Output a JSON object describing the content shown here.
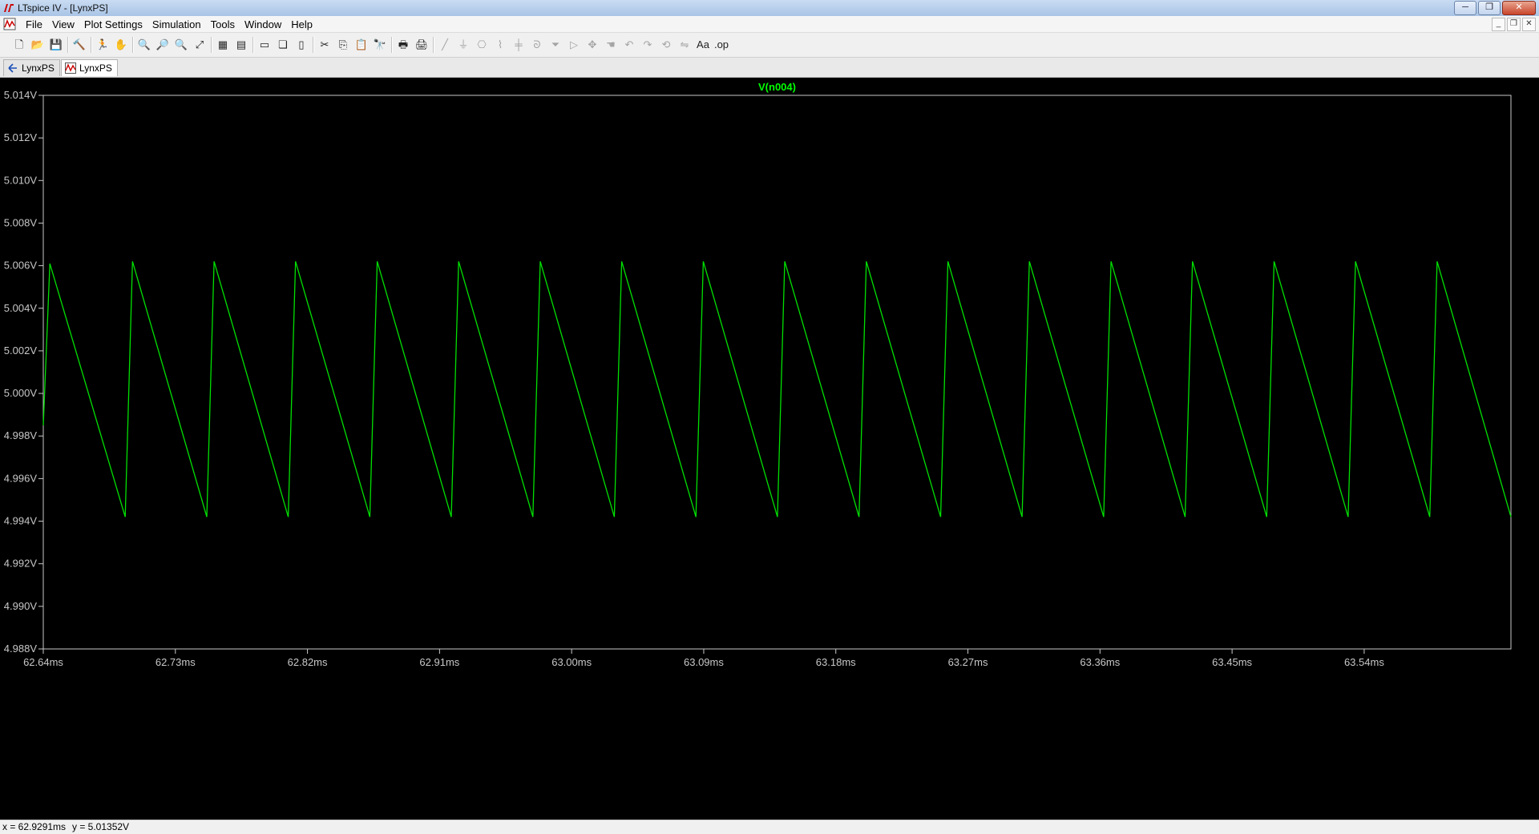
{
  "window": {
    "title": "LTspice IV - [LynxPS]",
    "buttons": {
      "minimize": "─",
      "restore": "❐",
      "close": "✕"
    }
  },
  "menubar": {
    "items": [
      "File",
      "View",
      "Plot Settings",
      "Simulation",
      "Tools",
      "Window",
      "Help"
    ],
    "mdi_buttons": {
      "minimize": "_",
      "restore": "❐",
      "close": "✕"
    }
  },
  "toolbar": {
    "buttons": [
      {
        "name": "open-schematic-icon",
        "glyph": "🗋"
      },
      {
        "name": "open-folder-icon",
        "glyph": "📂"
      },
      {
        "name": "save-icon",
        "glyph": "💾"
      },
      {
        "name": "control-panel-icon",
        "glyph": "🔨"
      },
      {
        "name": "run-icon",
        "glyph": "🏃"
      },
      {
        "name": "halt-icon",
        "glyph": "✋"
      },
      {
        "name": "zoom-in-icon",
        "glyph": "🔍"
      },
      {
        "name": "zoom-rect-icon",
        "glyph": "🔎"
      },
      {
        "name": "zoom-out-icon",
        "glyph": "🔍"
      },
      {
        "name": "zoom-fit-icon",
        "glyph": "⤢"
      },
      {
        "name": "autorange-icon",
        "glyph": "▦"
      },
      {
        "name": "grid-icon",
        "glyph": "▤"
      },
      {
        "name": "tile-horizontal-icon",
        "glyph": "▭"
      },
      {
        "name": "cascade-icon",
        "glyph": "❏"
      },
      {
        "name": "tile-vertical-icon",
        "glyph": "▯"
      },
      {
        "name": "cut-icon",
        "glyph": "✂"
      },
      {
        "name": "copy-icon",
        "glyph": "⎘"
      },
      {
        "name": "paste-icon",
        "glyph": "📋"
      },
      {
        "name": "find-icon",
        "glyph": "🔭"
      },
      {
        "name": "print-preview-icon",
        "glyph": "🖶"
      },
      {
        "name": "print-icon",
        "glyph": "🖨"
      },
      {
        "name": "wire-icon",
        "glyph": "╱"
      },
      {
        "name": "ground-icon",
        "glyph": "⏚"
      },
      {
        "name": "label-icon",
        "glyph": "⎔"
      },
      {
        "name": "resistor-icon",
        "glyph": "⌇"
      },
      {
        "name": "capacitor-icon",
        "glyph": "╪"
      },
      {
        "name": "inductor-icon",
        "glyph": "ᘐ"
      },
      {
        "name": "diode-icon",
        "glyph": "⏷"
      },
      {
        "name": "component-icon",
        "glyph": "▷"
      },
      {
        "name": "move-icon",
        "glyph": "✥"
      },
      {
        "name": "drag-icon",
        "glyph": "☚"
      },
      {
        "name": "undo-icon",
        "glyph": "↶"
      },
      {
        "name": "redo-icon",
        "glyph": "↷"
      },
      {
        "name": "rotate-icon",
        "glyph": "⟲"
      },
      {
        "name": "mirror-icon",
        "glyph": "⇋"
      },
      {
        "name": "text-icon",
        "glyph": "Aa"
      },
      {
        "name": "spice-directive-icon",
        "glyph": ".op"
      }
    ]
  },
  "tabs": [
    {
      "label": "LynxPS",
      "kind": "schematic"
    },
    {
      "label": "LynxPS",
      "kind": "waveform",
      "active": true
    }
  ],
  "status": {
    "x_readout": "x = 62.9291ms",
    "y_readout": "y = 5.01352V"
  },
  "colors": {
    "trace": "#00e000",
    "trace_label": "#00ff00",
    "axis": "#c8c8c8",
    "plot_bg": "#000000"
  },
  "chart_data": {
    "type": "line",
    "title": "V(n004)",
    "xlabel": "",
    "ylabel": "",
    "grid": false,
    "xlim": [
      62.64,
      63.64
    ],
    "ylim": [
      4.988,
      5.014
    ],
    "x_ticks": [
      "62.64ms",
      "62.73ms",
      "62.82ms",
      "62.91ms",
      "63.00ms",
      "63.09ms",
      "63.18ms",
      "63.27ms",
      "63.36ms",
      "63.45ms",
      "63.54ms"
    ],
    "y_ticks": [
      "5.014V",
      "5.012V",
      "5.010V",
      "5.008V",
      "5.006V",
      "5.004V",
      "5.002V",
      "5.000V",
      "4.998V",
      "4.996V",
      "4.994V",
      "4.992V",
      "4.990V",
      "4.988V"
    ],
    "series": [
      {
        "name": "V(n004)",
        "x_unit": "ms",
        "y_unit": "V",
        "points": [
          [
            62.64,
            4.9985
          ],
          [
            62.6445,
            5.0061
          ],
          [
            62.6958,
            4.9942
          ],
          [
            62.7008,
            5.0062
          ],
          [
            62.7514,
            4.9942
          ],
          [
            62.7564,
            5.0062
          ],
          [
            62.8069,
            4.9942
          ],
          [
            62.8119,
            5.0062
          ],
          [
            62.8625,
            4.9942
          ],
          [
            62.8675,
            5.0062
          ],
          [
            62.918,
            4.9942
          ],
          [
            62.923,
            5.0062
          ],
          [
            62.9736,
            4.9942
          ],
          [
            62.9786,
            5.0062
          ],
          [
            63.0291,
            4.9942
          ],
          [
            63.0341,
            5.0062
          ],
          [
            63.0847,
            4.9942
          ],
          [
            63.0897,
            5.0062
          ],
          [
            63.1402,
            4.9942
          ],
          [
            63.1452,
            5.0062
          ],
          [
            63.1958,
            4.9942
          ],
          [
            63.2008,
            5.0062
          ],
          [
            63.2514,
            4.9942
          ],
          [
            63.2564,
            5.0062
          ],
          [
            63.3069,
            4.9942
          ],
          [
            63.3119,
            5.0062
          ],
          [
            63.3625,
            4.9942
          ],
          [
            63.3675,
            5.0062
          ],
          [
            63.418,
            4.9942
          ],
          [
            63.423,
            5.0062
          ],
          [
            63.4736,
            4.9942
          ],
          [
            63.4786,
            5.0062
          ],
          [
            63.5291,
            4.9942
          ],
          [
            63.5341,
            5.0062
          ],
          [
            63.5847,
            4.9942
          ],
          [
            63.5897,
            5.0062
          ],
          [
            63.64,
            4.9942
          ]
        ]
      }
    ]
  }
}
